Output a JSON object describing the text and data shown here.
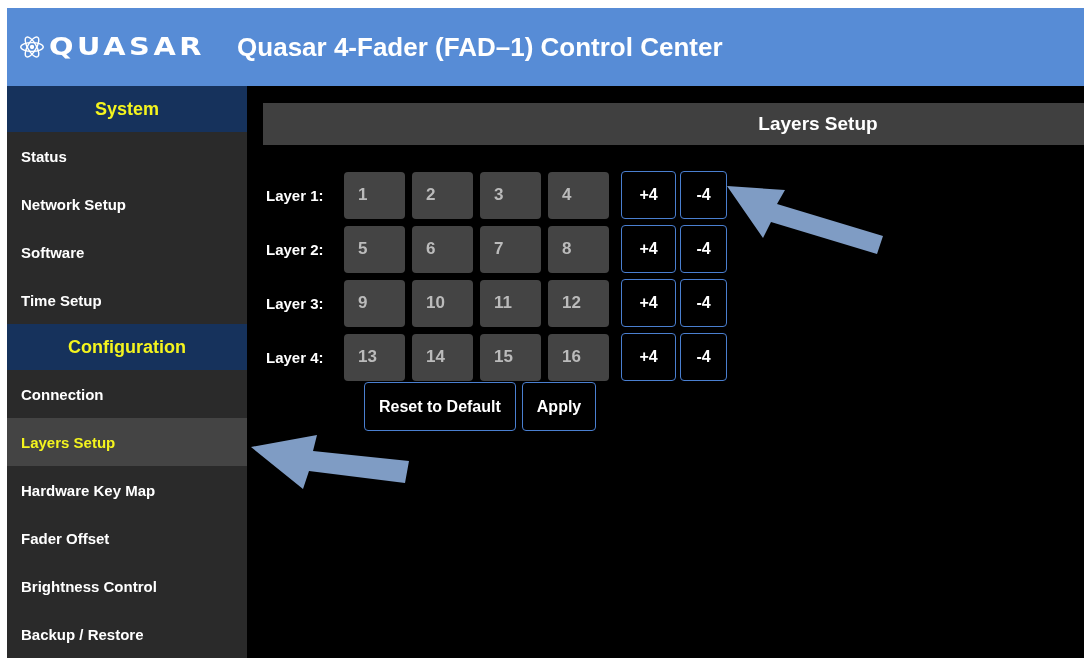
{
  "header": {
    "logo": "QUASAR",
    "title": "Quasar 4-Fader (FAD–1) Control Center"
  },
  "sidebar": {
    "sections": [
      {
        "title": "System",
        "items": [
          {
            "label": "Status",
            "selected": false
          },
          {
            "label": "Network Setup",
            "selected": false
          },
          {
            "label": "Software",
            "selected": false
          },
          {
            "label": "Time Setup",
            "selected": false
          }
        ]
      },
      {
        "title": "Configuration",
        "items": [
          {
            "label": "Connection",
            "selected": false
          },
          {
            "label": "Layers Setup",
            "selected": true
          },
          {
            "label": "Hardware Key Map",
            "selected": false
          },
          {
            "label": "Fader Offset",
            "selected": false
          },
          {
            "label": "Brightness Control",
            "selected": false
          },
          {
            "label": "Backup / Restore",
            "selected": false
          }
        ]
      }
    ]
  },
  "page_title": "Layers Setup",
  "layers": [
    {
      "label": "Layer 1:",
      "faders": [
        "1",
        "2",
        "3",
        "4"
      ],
      "plus": "+4",
      "minus": "-4"
    },
    {
      "label": "Layer 2:",
      "faders": [
        "5",
        "6",
        "7",
        "8"
      ],
      "plus": "+4",
      "minus": "-4"
    },
    {
      "label": "Layer 3:",
      "faders": [
        "9",
        "10",
        "11",
        "12"
      ],
      "plus": "+4",
      "minus": "-4"
    },
    {
      "label": "Layer 4:",
      "faders": [
        "13",
        "14",
        "15",
        "16"
      ],
      "plus": "+4",
      "minus": "-4"
    }
  ],
  "buttons": [
    "Reset to Default",
    "Apply"
  ]
}
